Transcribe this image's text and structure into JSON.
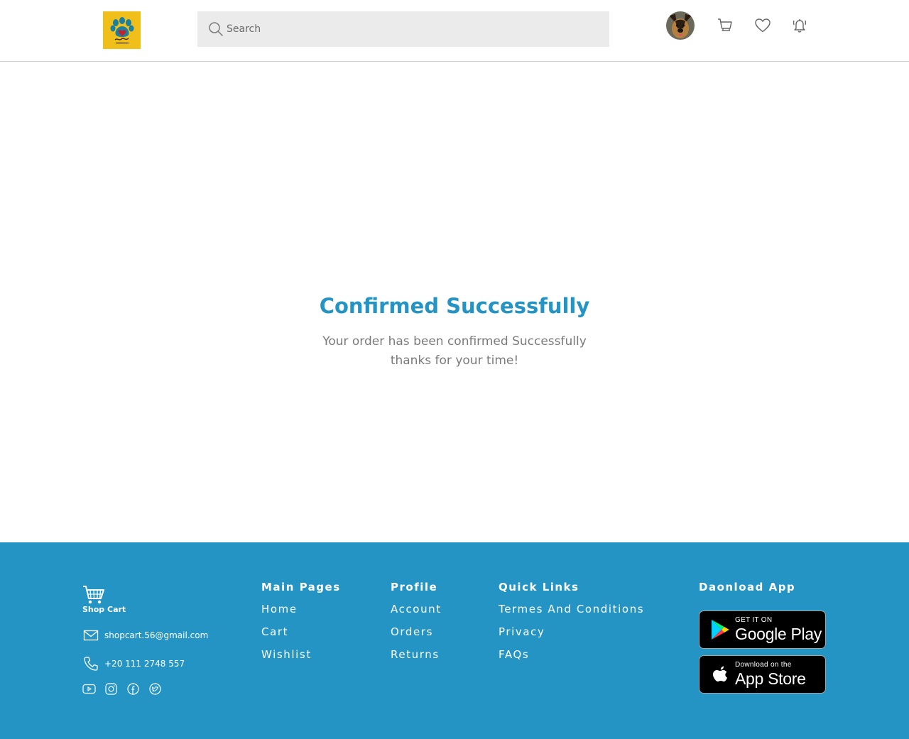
{
  "header": {
    "logo_alt": "PetMates",
    "search": {
      "placeholder": "Search",
      "value": ""
    },
    "icons": [
      "avatar",
      "cart-icon",
      "heart-icon",
      "bell-icon"
    ]
  },
  "main": {
    "title": "Confirmed Successfully",
    "message_line1": "Your order has been confirmed Successfully",
    "message_line2": "thanks for your time!"
  },
  "footer": {
    "brand": "Shop Cart",
    "email": "shopcart.56@gmail.com",
    "phone": "+20 111 2748 557",
    "socials": [
      "youtube-icon",
      "instagram-icon",
      "facebook-icon",
      "twitter-icon"
    ],
    "columns": [
      {
        "heading": "Main Pages",
        "links": [
          "Home",
          "Cart",
          "Wishlist"
        ]
      },
      {
        "heading": "Profile",
        "links": [
          "Account",
          "Orders",
          "Returns"
        ]
      },
      {
        "heading": "Quick Links",
        "links": [
          "Termes And Conditions",
          "Privacy",
          "FAQs"
        ]
      }
    ],
    "download": {
      "heading": "Daonload App",
      "google_small": "GET IT ON",
      "google_big": "Google Play",
      "apple_small": "Download on the",
      "apple_big": "App Store"
    }
  },
  "colors": {
    "accent": "#2394c4",
    "logo_bg": "#f0bf1a",
    "search_bg": "#ebebeb"
  }
}
